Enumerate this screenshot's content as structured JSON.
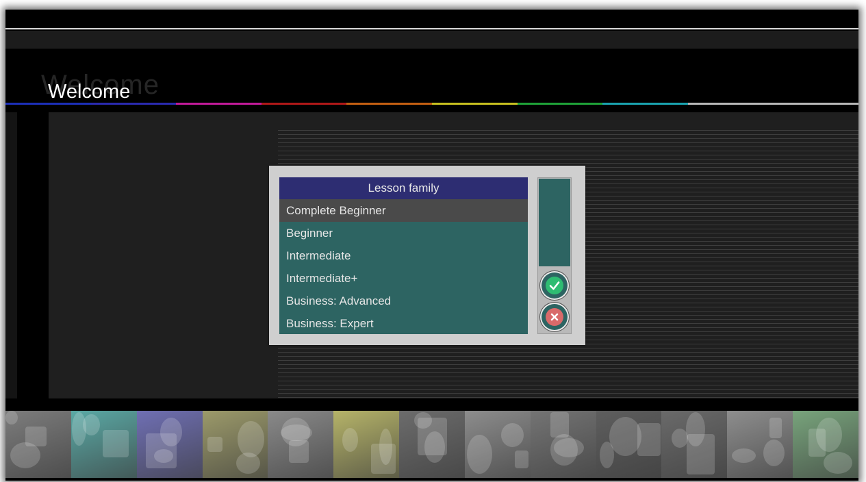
{
  "header": {
    "title": "Welcome",
    "title_ghost": "Welcome",
    "rainbow_colors": [
      "#1c2fb8",
      "#2a2ab0",
      "#c21a9a",
      "#b01818",
      "#c46012",
      "#c8c020",
      "#1fa238",
      "#1aa3b0",
      "#b8b8b8",
      "#b8b8b8"
    ]
  },
  "dialog": {
    "header": "Lesson family",
    "items": [
      {
        "label": "Complete Beginner",
        "selected": true
      },
      {
        "label": "Beginner",
        "selected": false
      },
      {
        "label": "Intermediate",
        "selected": false
      },
      {
        "label": "Intermediate+",
        "selected": false
      },
      {
        "label": "Business: Advanced",
        "selected": false
      },
      {
        "label": "Business: Expert",
        "selected": false
      }
    ],
    "ok_icon": "check-icon",
    "cancel_icon": "close-icon",
    "colors": {
      "header": "#2d2d72",
      "list": "#2d6462",
      "selected": "#4a4a4a",
      "ok": "#2ebc72",
      "cancel": "#d96a6a"
    }
  },
  "photo_strip": {
    "photos": [
      {
        "name": "photo-people-gray",
        "color": "#7d7d7d"
      },
      {
        "name": "photo-map-teal",
        "color": "#5aa9a5"
      },
      {
        "name": "photo-map-purple",
        "color": "#6f6fb4"
      },
      {
        "name": "photo-sheep-olive",
        "color": "#9c9a6a"
      },
      {
        "name": "photo-workers-gray",
        "color": "#8a8a8a"
      },
      {
        "name": "photo-trees-yellow",
        "color": "#b6b469"
      },
      {
        "name": "photo-children-gray",
        "color": "#6c6c6c"
      },
      {
        "name": "photo-train-gray",
        "color": "#8d8d8d"
      },
      {
        "name": "photo-soldiers-gray",
        "color": "#747474"
      },
      {
        "name": "photo-woman-gray",
        "color": "#5e5e5e"
      },
      {
        "name": "photo-crowd-gray",
        "color": "#6a6a6a"
      },
      {
        "name": "photo-hands-gray",
        "color": "#8e8e8e"
      },
      {
        "name": "photo-family-green",
        "color": "#78a47c"
      }
    ]
  }
}
